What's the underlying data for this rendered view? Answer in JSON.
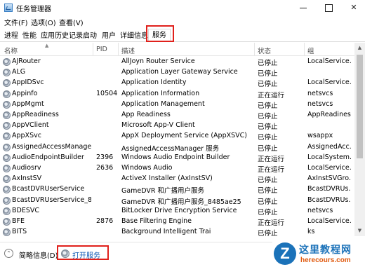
{
  "window": {
    "title": "任务管理器"
  },
  "menu": [
    "文件(F)",
    "选项(O)",
    "查看(V)"
  ],
  "tabs": [
    "进程",
    "性能",
    "应用历史记录",
    "启动",
    "用户",
    "详细信息",
    "服务"
  ],
  "active_tab": "服务",
  "columns": {
    "name": "名称",
    "pid": "PID",
    "desc": "描述",
    "status": "状态",
    "group": "组"
  },
  "services": [
    {
      "name": "AJRouter",
      "pid": "",
      "desc": "AllJoyn Router Service",
      "status": "已停止",
      "group": "LocalService..."
    },
    {
      "name": "ALG",
      "pid": "",
      "desc": "Application Layer Gateway Service",
      "status": "已停止",
      "group": ""
    },
    {
      "name": "AppIDSvc",
      "pid": "",
      "desc": "Application Identity",
      "status": "已停止",
      "group": "LocalService..."
    },
    {
      "name": "Appinfo",
      "pid": "10504",
      "desc": "Application Information",
      "status": "正在运行",
      "group": "netsvcs"
    },
    {
      "name": "AppMgmt",
      "pid": "",
      "desc": "Application Management",
      "status": "已停止",
      "group": "netsvcs"
    },
    {
      "name": "AppReadiness",
      "pid": "",
      "desc": "App Readiness",
      "status": "已停止",
      "group": "AppReadiness"
    },
    {
      "name": "AppVClient",
      "pid": "",
      "desc": "Microsoft App-V Client",
      "status": "已停止",
      "group": ""
    },
    {
      "name": "AppXSvc",
      "pid": "",
      "desc": "AppX Deployment Service (AppXSVC)",
      "status": "已停止",
      "group": "wsappx"
    },
    {
      "name": "AssignedAccessManager...",
      "pid": "",
      "desc": "AssignedAccessManager 服务",
      "status": "已停止",
      "group": "AssignedAcc..."
    },
    {
      "name": "AudioEndpointBuilder",
      "pid": "2396",
      "desc": "Windows Audio Endpoint Builder",
      "status": "正在运行",
      "group": "LocalSystem..."
    },
    {
      "name": "Audiosrv",
      "pid": "2636",
      "desc": "Windows Audio",
      "status": "正在运行",
      "group": "LocalService..."
    },
    {
      "name": "AxInstSV",
      "pid": "",
      "desc": "ActiveX Installer (AxInstSV)",
      "status": "已停止",
      "group": "AxInstSVGro..."
    },
    {
      "name": "BcastDVRUserService",
      "pid": "",
      "desc": "GameDVR 和广播用户服务",
      "status": "已停止",
      "group": "BcastDVRUs..."
    },
    {
      "name": "BcastDVRUserService_84...",
      "pid": "",
      "desc": "GameDVR 和广播用户服务_8485ae25",
      "status": "已停止",
      "group": "BcastDVRUs..."
    },
    {
      "name": "BDESVC",
      "pid": "",
      "desc": "BitLocker Drive Encryption Service",
      "status": "已停止",
      "group": "netsvcs"
    },
    {
      "name": "BFE",
      "pid": "2876",
      "desc": "Base Filtering Engine",
      "status": "正在运行",
      "group": "LocalService..."
    },
    {
      "name": "BITS",
      "pid": "",
      "desc": "Background Intelligent Trai",
      "status": "已停止",
      "group": "ks"
    }
  ],
  "footer": {
    "brief": "简略信息(D)",
    "open_services": "打开服务"
  },
  "watermark": {
    "logo_letter": "Z",
    "main": "这里教程网",
    "sub": "herecours.com"
  }
}
